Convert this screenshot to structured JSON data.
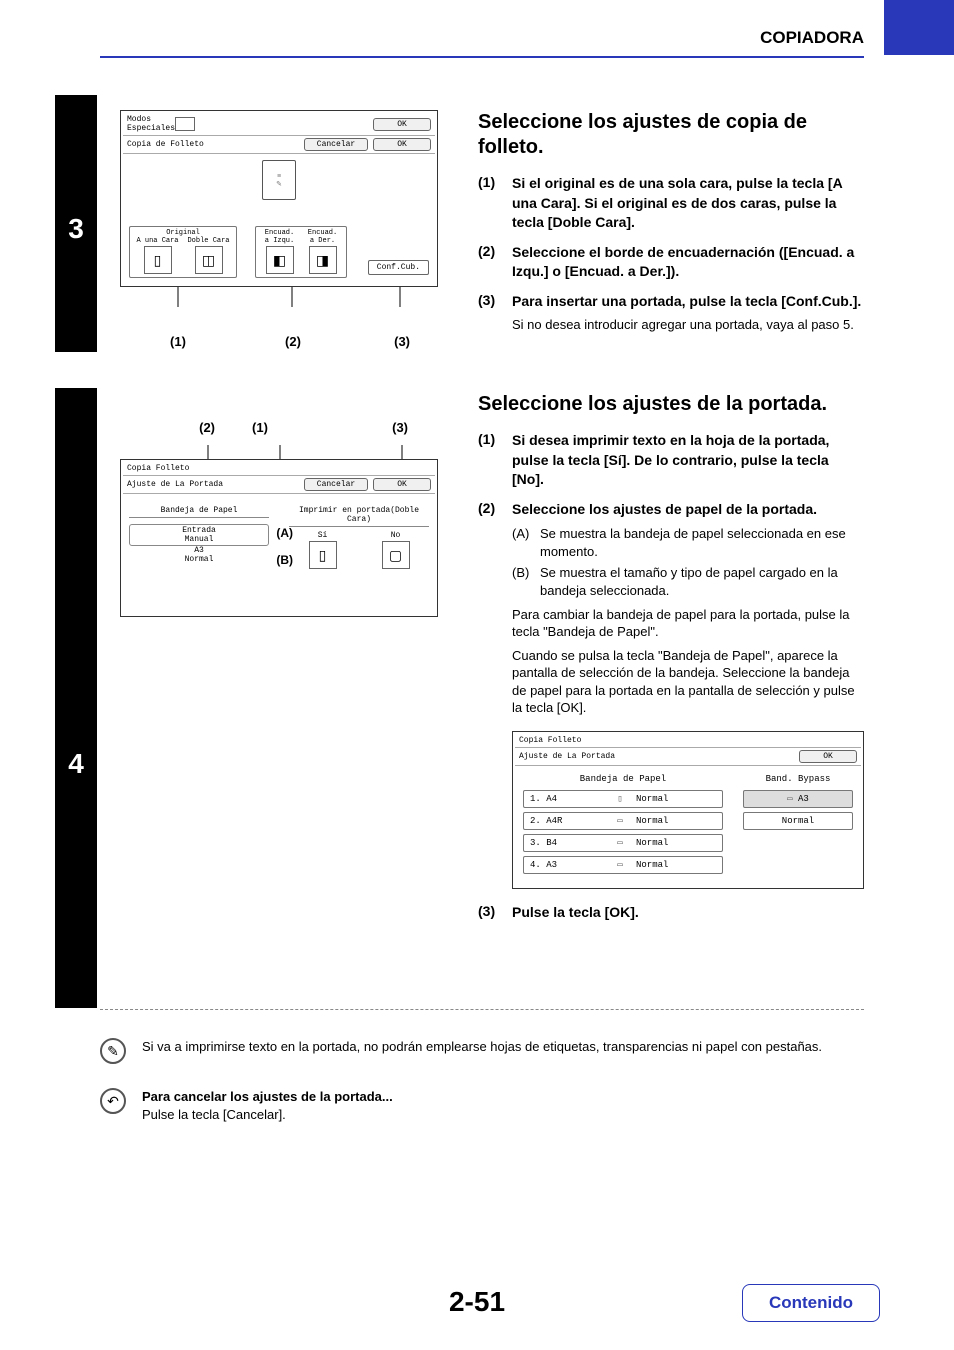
{
  "header": {
    "section": "COPIADORA"
  },
  "step3": {
    "number": "3",
    "panel": {
      "modes_label": "Modos\nEspeciales",
      "header_ok": "OK",
      "row2_title": "Copia de Folleto",
      "cancel": "Cancelar",
      "ok": "OK",
      "original_label": "Original",
      "one_side": "A una Cara",
      "two_side": "Doble Cara",
      "bind_left": "Encuad.\na Izqu.",
      "bind_right": "Encuad.\na Der.",
      "conf_cub": "Conf.Cub."
    },
    "callouts": {
      "c1": "(1)",
      "c2": "(2)",
      "c3": "(3)"
    },
    "heading": "Seleccione los ajustes de copia de folleto.",
    "items": [
      {
        "num": "(1)",
        "text": "Si el original es de una sola cara, pulse la tecla [A una Cara]. Si el original es de dos caras, pulse la tecla [Doble Cara]."
      },
      {
        "num": "(2)",
        "text": "Seleccione el borde de encuadernación ([Encuad. a Izqu.] o [Encuad. a Der.])."
      },
      {
        "num": "(3)",
        "text": "Para insertar una portada, pulse la tecla [Conf.Cub.].",
        "sub": "Si no desea introducir agregar una portada, vaya al paso 5."
      }
    ]
  },
  "step4": {
    "number": "4",
    "callouts_top": {
      "c1": "(1)",
      "c2": "(2)",
      "c3": "(3)"
    },
    "panel": {
      "title": "Copia Folleto",
      "subtitle": "Ajuste de La Portada",
      "cancel": "Cancelar",
      "ok": "OK",
      "tray_label": "Bandeja de Papel",
      "print_label": "Imprimir en portada(Doble Cara)",
      "si": "Sí",
      "no": "No",
      "entrada_manual": "Entrada\nManual",
      "a3": "A3",
      "normal": "Normal",
      "A": "(A)",
      "B": "(B)"
    },
    "heading": "Seleccione los ajustes de la portada.",
    "items": [
      {
        "num": "(1)",
        "text": "Si desea imprimir texto en la hoja de la portada, pulse la tecla [Sí]. De lo contrario, pulse la tecla [No]."
      },
      {
        "num": "(2)",
        "text": "Seleccione los ajustes de papel de la portada."
      }
    ],
    "subitems": [
      {
        "tag": "(A)",
        "text": "Se muestra la bandeja de papel seleccionada en ese momento."
      },
      {
        "tag": "(B)",
        "text": "Se muestra el tamaño y tipo de papel cargado en la bandeja seleccionada."
      }
    ],
    "para1": "Para cambiar la bandeja de papel para la portada, pulse la tecla \"Bandeja de Papel\".",
    "para2": "Cuando se pulsa la tecla \"Bandeja de Papel\", aparece la pantalla de selección de la bandeja. Seleccione la bandeja de papel para la portada en la pantalla de selección y pulse la tecla [OK].",
    "tray_panel": {
      "title": "Copia Folleto",
      "subtitle": "Ajuste de La Portada",
      "ok": "OK",
      "col_tray": "Bandeja de Papel",
      "col_bypass": "Band. Bypass",
      "rows": [
        {
          "left": "1. A4",
          "right": "Normal"
        },
        {
          "left": "2. A4R",
          "right": "Normal"
        },
        {
          "left": "3. B4",
          "right": "Normal"
        },
        {
          "left": "4. A3",
          "right": "Normal"
        }
      ],
      "bypass_top": "A3",
      "bypass_bottom": "Normal"
    },
    "item3": {
      "num": "(3)",
      "text": "Pulse la tecla [OK]."
    }
  },
  "note1": "Si va a imprimirse texto en la portada, no podrán emplearse hojas de etiquetas, transparencias ni papel con pestañas.",
  "note2": {
    "title": "Para cancelar los ajustes de la portada...",
    "text": "Pulse la tecla [Cancelar]."
  },
  "page_number": "2-51",
  "contents_link": "Contenido"
}
